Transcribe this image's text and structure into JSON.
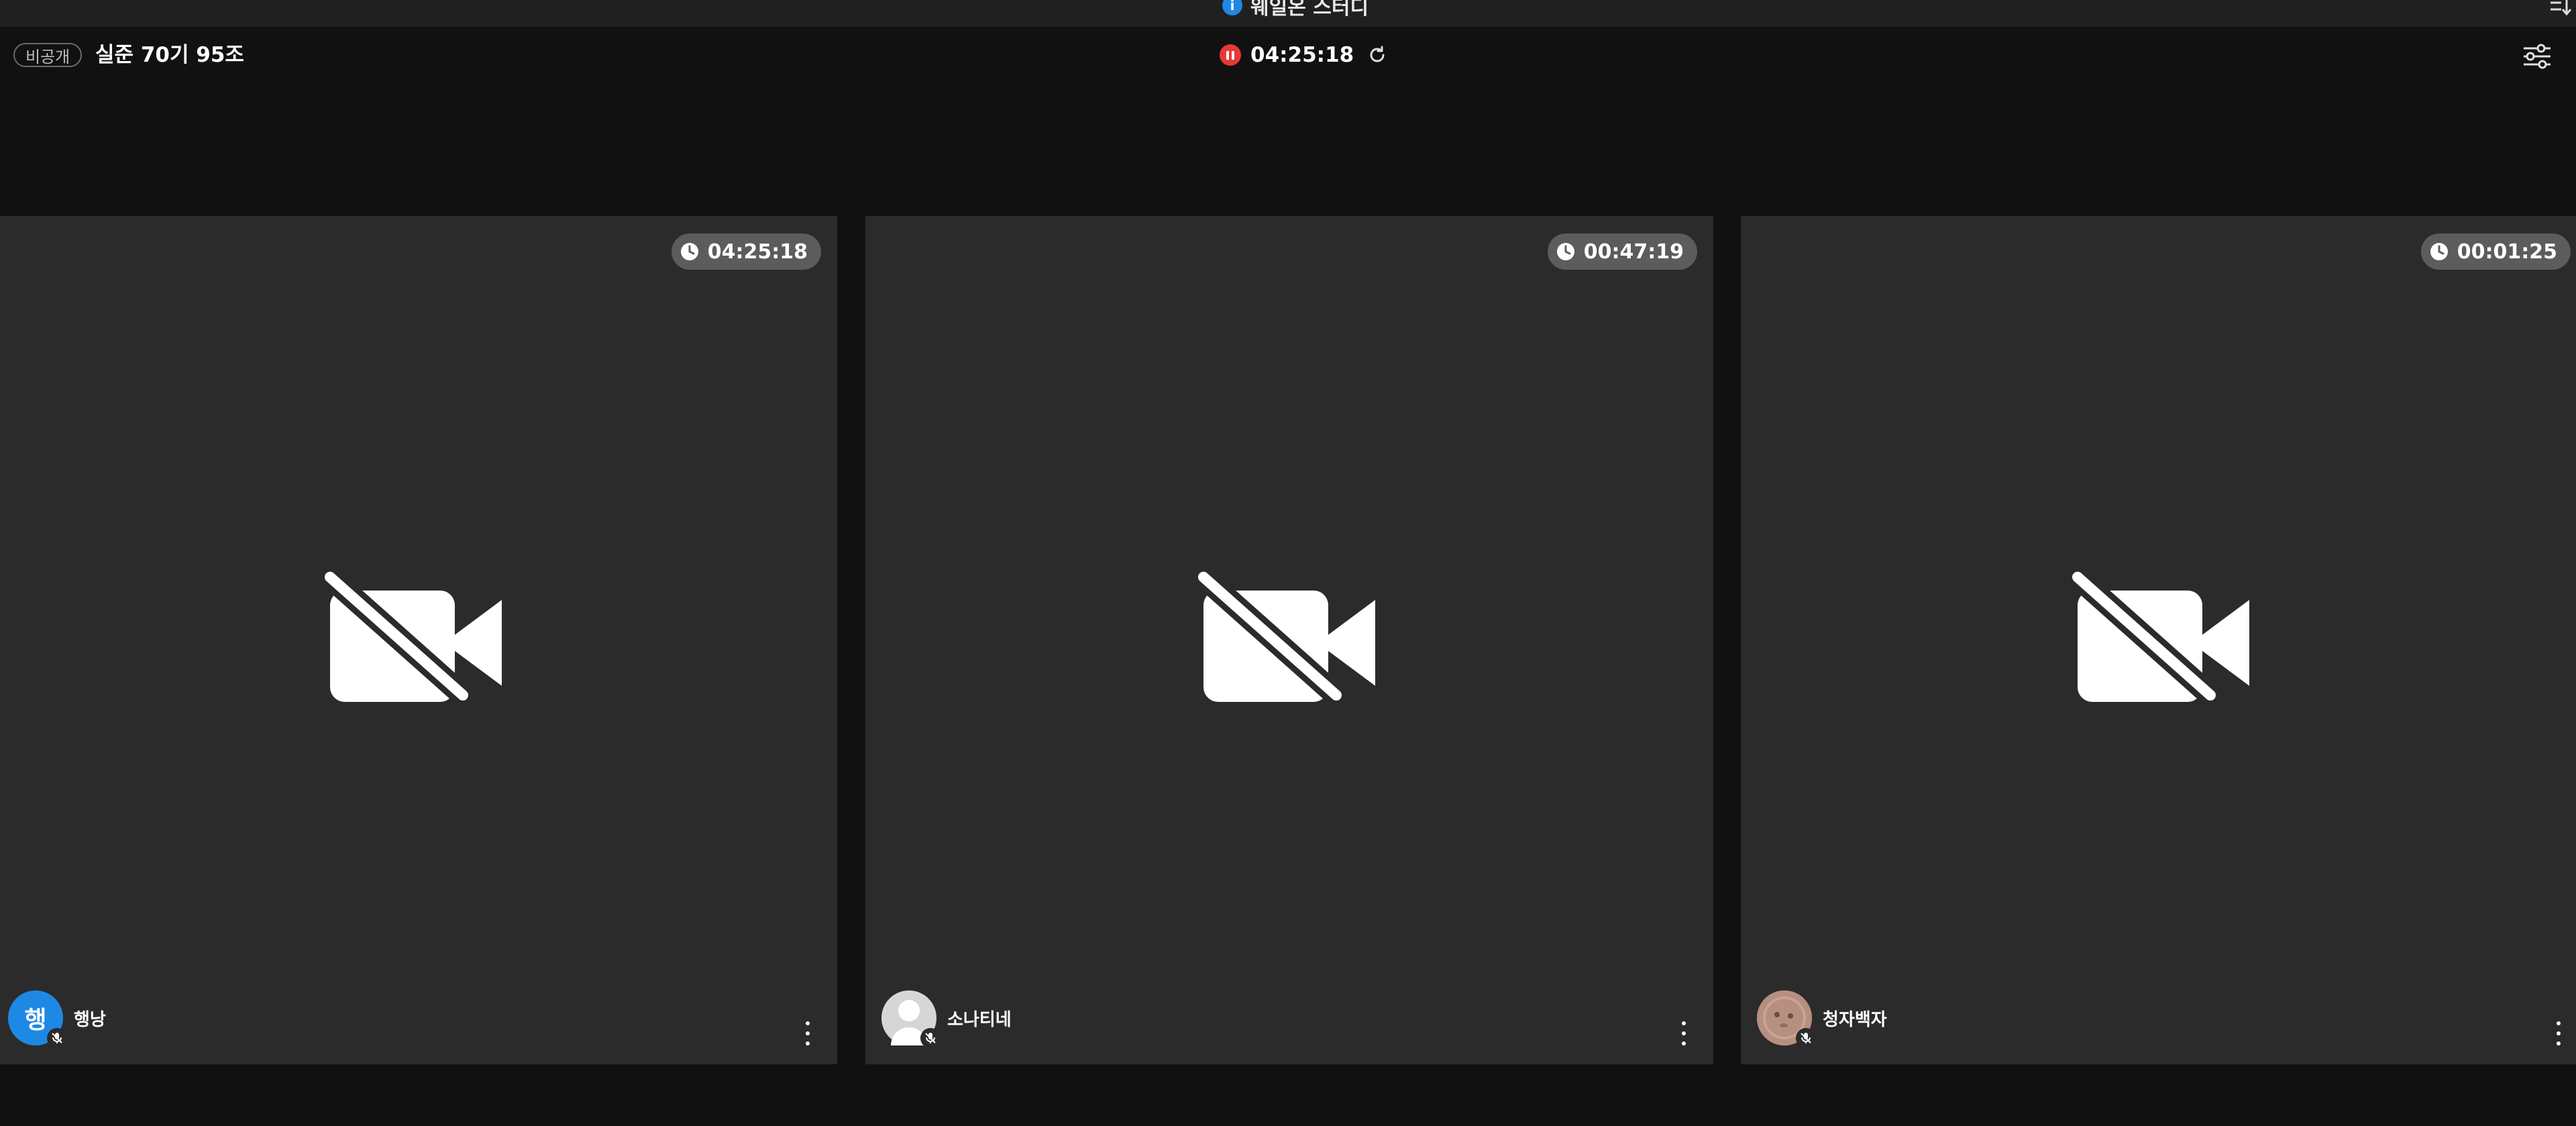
{
  "notice": {
    "icon": "info-icon",
    "icon_glyph": "i",
    "text": "웨일온 스터디"
  },
  "room": {
    "privacy_label": "비공개",
    "title": "실준 70기 95조",
    "timer": "04:25:18",
    "timer_status": "paused"
  },
  "tiles": [
    {
      "elapsed": "04:25:18",
      "name": "행낭",
      "avatar_letter": "행",
      "avatar_type": "letter",
      "camera": "off",
      "mic": "off"
    },
    {
      "elapsed": "00:47:19",
      "name": "소나티네",
      "avatar_letter": "",
      "avatar_type": "default",
      "camera": "off",
      "mic": "off"
    },
    {
      "elapsed": "00:01:25",
      "name": "청자백자",
      "avatar_letter": "",
      "avatar_type": "photo",
      "camera": "off",
      "mic": "off"
    }
  ],
  "colors": {
    "background": "#111111",
    "tile": "#2b2b2b",
    "accent_blue": "#1e88e5",
    "record_red": "#e53935",
    "pill": "#5c5c5c"
  }
}
